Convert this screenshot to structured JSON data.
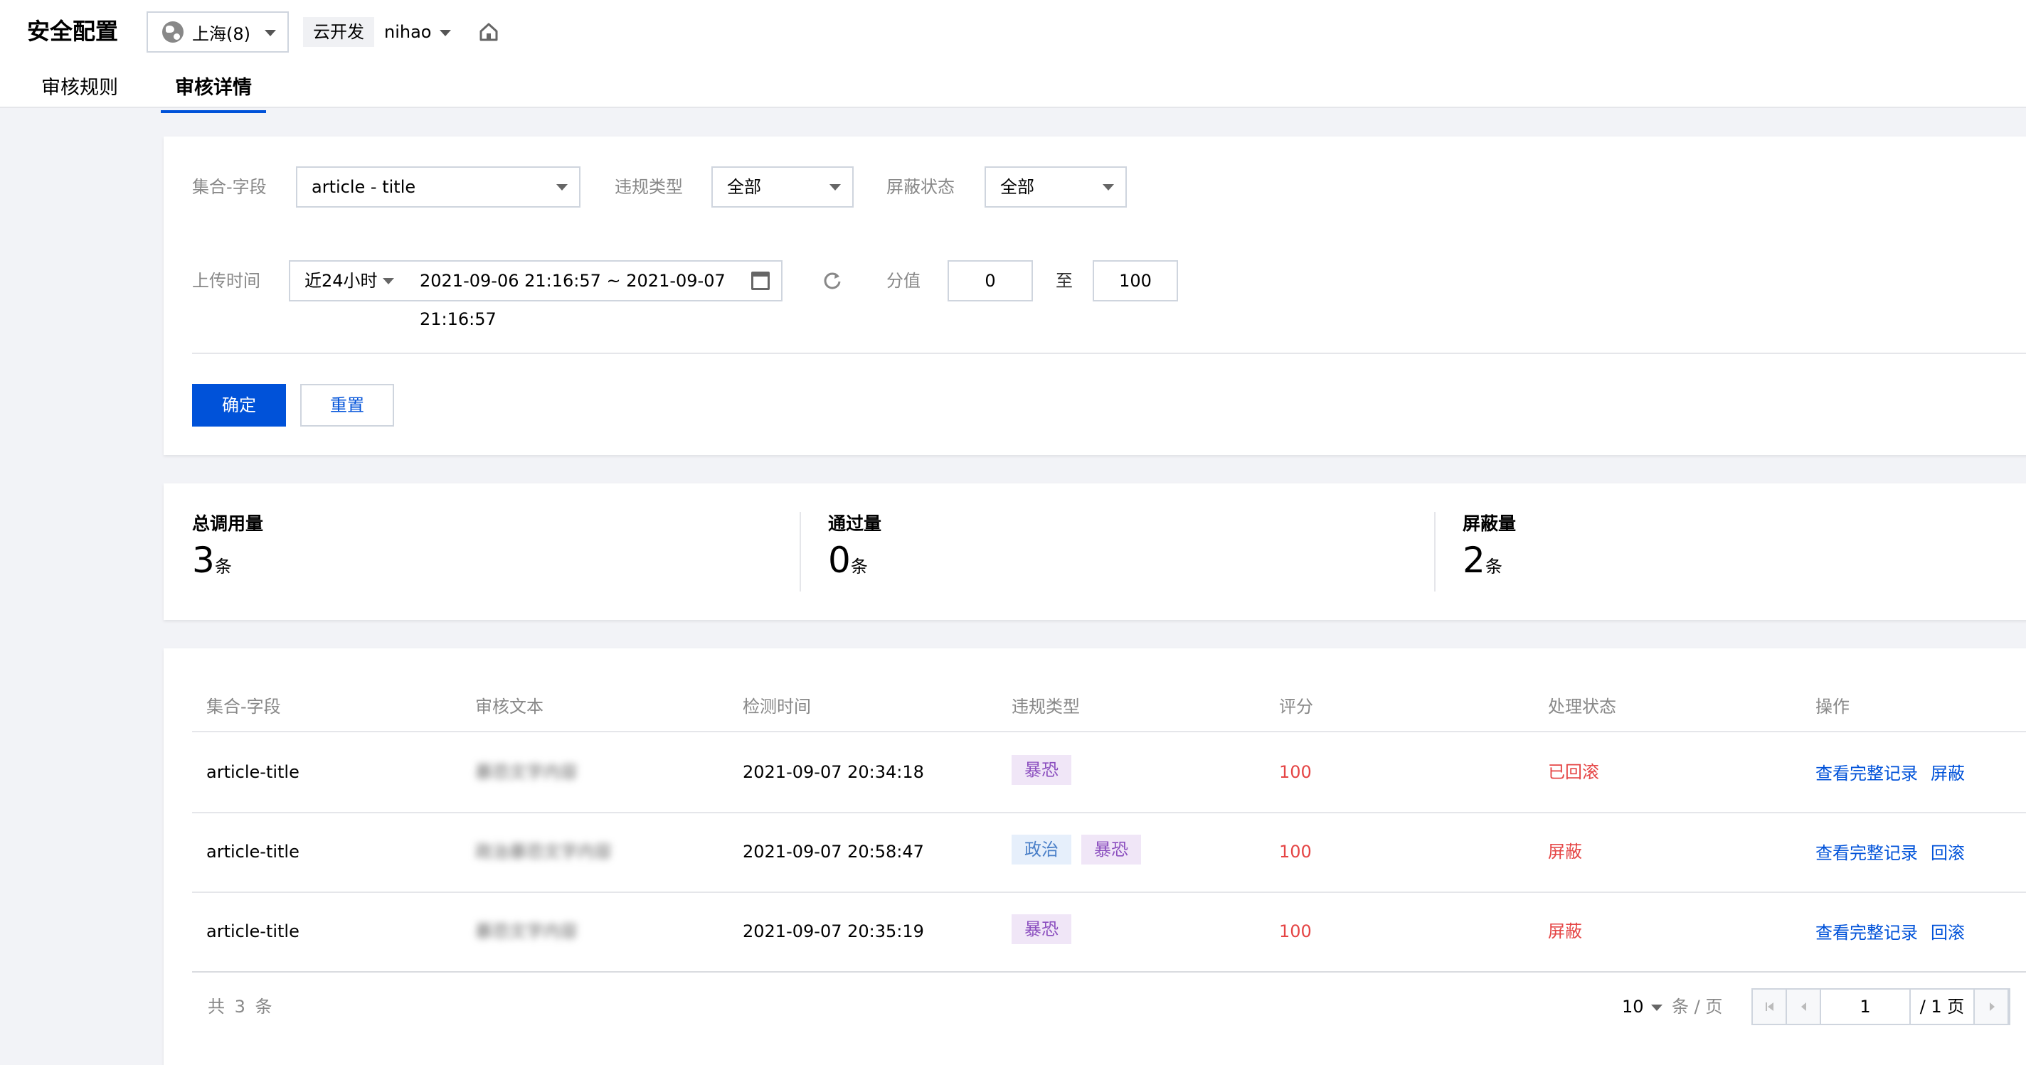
{
  "header": {
    "title": "安全配置",
    "region": "上海(8)",
    "env_label": "云开发",
    "env_name": "nihao"
  },
  "tabs": [
    {
      "label": "审核规则",
      "active": false
    },
    {
      "label": "审核详情",
      "active": true
    }
  ],
  "filters": {
    "collection_label": "集合-字段",
    "collection_value": "article - title",
    "violation_label": "违规类型",
    "violation_value": "全部",
    "block_label": "屏蔽状态",
    "block_value": "全部",
    "upload_label": "上传时间",
    "time_preset": "近24小时",
    "date_range": "2021-09-06 21:16:57 ~ 2021-09-07 21:16:57",
    "score_label": "分值",
    "score_min": "0",
    "score_to": "至",
    "score_max": "100",
    "confirm_label": "确定",
    "reset_label": "重置"
  },
  "stats": [
    {
      "label": "总调用量",
      "value": "3",
      "unit": "条"
    },
    {
      "label": "通过量",
      "value": "0",
      "unit": "条"
    },
    {
      "label": "屏蔽量",
      "value": "2",
      "unit": "条"
    }
  ],
  "table": {
    "columns": [
      "集合-字段",
      "审核文本",
      "检测时间",
      "违规类型",
      "评分",
      "处理状态",
      "操作"
    ],
    "rows": [
      {
        "field": "article-title",
        "text": "暴恐文字内容",
        "time": "2021-09-07 20:34:18",
        "tags": [
          "暴恐"
        ],
        "score": "100",
        "status": "已回滚",
        "action_view": "查看完整记录",
        "action_op": "屏蔽"
      },
      {
        "field": "article-title",
        "text": "政治暴恐文字内容",
        "time": "2021-09-07 20:58:47",
        "tags": [
          "政治",
          "暴恐"
        ],
        "score": "100",
        "status": "屏蔽",
        "action_view": "查看完整记录",
        "action_op": "回滚"
      },
      {
        "field": "article-title",
        "text": "暴恐文字内容",
        "time": "2021-09-07 20:35:19",
        "tags": [
          "暴恐"
        ],
        "score": "100",
        "status": "屏蔽",
        "action_view": "查看完整记录",
        "action_op": "回滚"
      }
    ],
    "total_text": "共 3 条",
    "page_size": "10",
    "per_page_text": "条 / 页",
    "current_page": "1",
    "total_pages_text": "/ 1 页"
  },
  "colors": {
    "primary": "#0052d9",
    "danger": "#e54545",
    "tag_purple": "#8b4fbf",
    "tag_blue": "#4a7fc8"
  }
}
